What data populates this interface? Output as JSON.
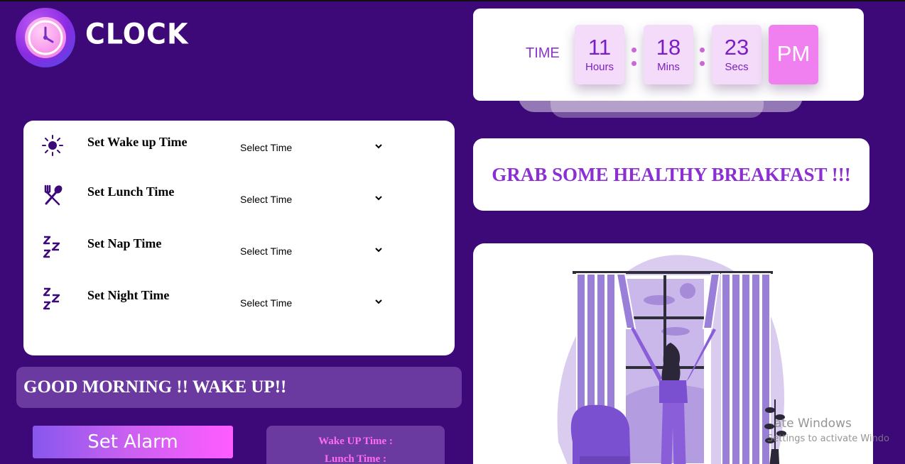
{
  "app": {
    "title": "CLOCK"
  },
  "clock": {
    "label": "TIME",
    "hours": "11",
    "hours_unit": "Hours",
    "mins": "18",
    "mins_unit": "Mins",
    "secs": "23",
    "secs_unit": "Secs",
    "ampm": "PM"
  },
  "settings": {
    "rows": [
      {
        "label": "Set Wake up Time",
        "icon": "sun-icon",
        "select": "Select Time"
      },
      {
        "label": "Set Lunch Time",
        "icon": "fork-spoon-icon",
        "select": "Select Time"
      },
      {
        "label": "Set Nap Time",
        "icon": "sleep-zzz-icon",
        "select": "Select Time"
      },
      {
        "label": "Set Night Time",
        "icon": "sleep-zzz-icon",
        "select": "Select Time"
      }
    ]
  },
  "messages": {
    "grab": "GRAB SOME HEALTHY BREAKFAST !!!",
    "greeting": "GOOD MORNING !! WAKE UP!!"
  },
  "button": {
    "label": "Set Alarm"
  },
  "summary": {
    "wake": "Wake UP Time :",
    "lunch": "Lunch Time :"
  },
  "watermark": {
    "line1": "ate Windows",
    "line2": "Settings to activate Windo"
  },
  "colors": {
    "background": "#3d0878",
    "accent": "#8b2fd4",
    "pink": "#f07ff0"
  }
}
